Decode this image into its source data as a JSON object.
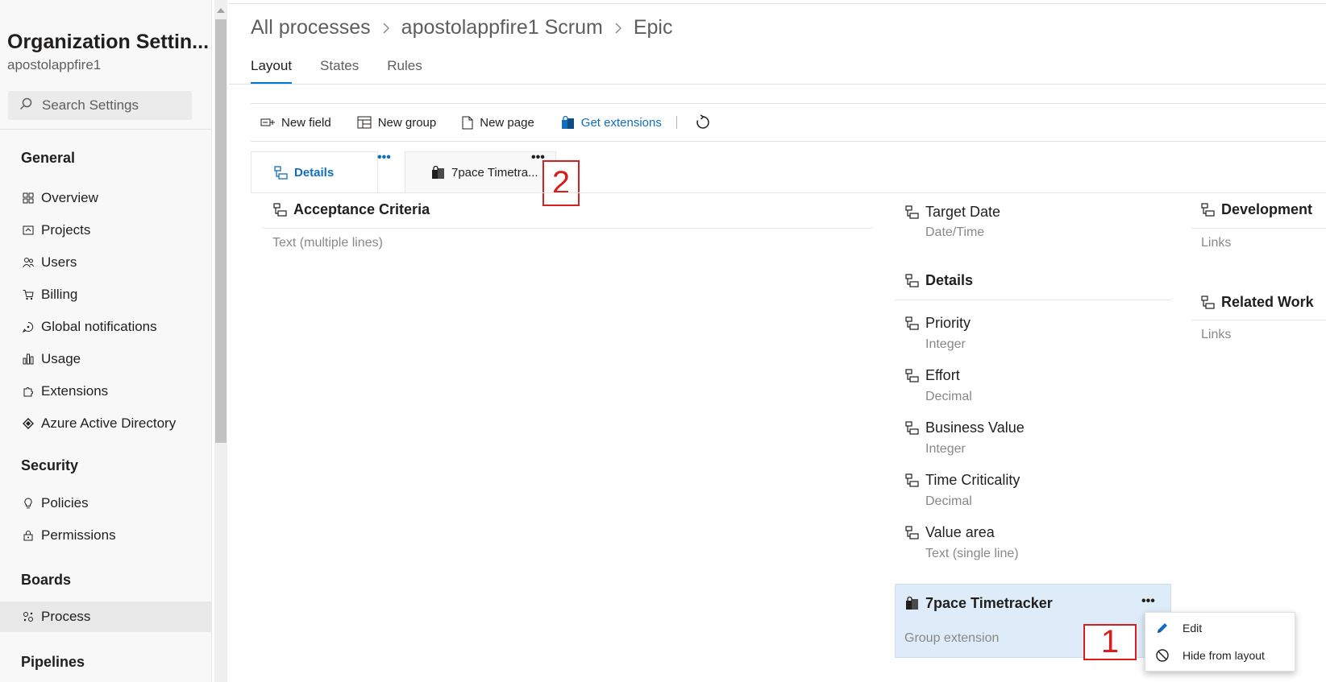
{
  "sidebar": {
    "title": "Organization Settin...",
    "subtitle": "apostolappfire1",
    "search_placeholder": "Search Settings",
    "sections": {
      "general": "General",
      "security": "Security",
      "boards": "Boards",
      "pipelines": "Pipelines"
    },
    "items": {
      "overview": "Overview",
      "projects": "Projects",
      "users": "Users",
      "billing": "Billing",
      "global_notifications": "Global notifications",
      "usage": "Usage",
      "extensions": "Extensions",
      "azure_ad": "Azure Active Directory",
      "policies": "Policies",
      "permissions": "Permissions",
      "process": "Process"
    }
  },
  "breadcrumb": {
    "root": "All processes",
    "process": "apostolappfire1 Scrum",
    "type": "Epic"
  },
  "tabs": {
    "layout": "Layout",
    "states": "States",
    "rules": "Rules"
  },
  "toolbar": {
    "new_field": "New field",
    "new_group": "New group",
    "new_page": "New page",
    "get_extensions": "Get extensions"
  },
  "page_tabs": {
    "details": "Details",
    "seven_pace": "7pace Timetra..."
  },
  "annotations": {
    "one": "1",
    "two": "2"
  },
  "layout": {
    "col1": {
      "group": "Acceptance Criteria",
      "type": "Text (multiple lines)"
    },
    "col2": {
      "target_date": {
        "name": "Target Date",
        "type": "Date/Time"
      },
      "details_group": "Details",
      "fields": [
        {
          "name": "Priority",
          "type": "Integer"
        },
        {
          "name": "Effort",
          "type": "Decimal"
        },
        {
          "name": "Business Value",
          "type": "Integer"
        },
        {
          "name": "Time Criticality",
          "type": "Decimal"
        },
        {
          "name": "Value area",
          "type": "Text (single line)"
        }
      ],
      "extension_group": {
        "name": "7pace Timetracker",
        "type": "Group extension"
      }
    },
    "col3": {
      "development": {
        "name": "Development",
        "type": "Links"
      },
      "related_work": {
        "name": "Related Work",
        "type": "Links"
      }
    }
  },
  "context_menu": {
    "edit": "Edit",
    "hide": "Hide from layout"
  },
  "colors": {
    "accent": "#0078d4",
    "link": "#106ebe",
    "annotation": "#d81e1e",
    "extension_bg": "#deecf9"
  }
}
